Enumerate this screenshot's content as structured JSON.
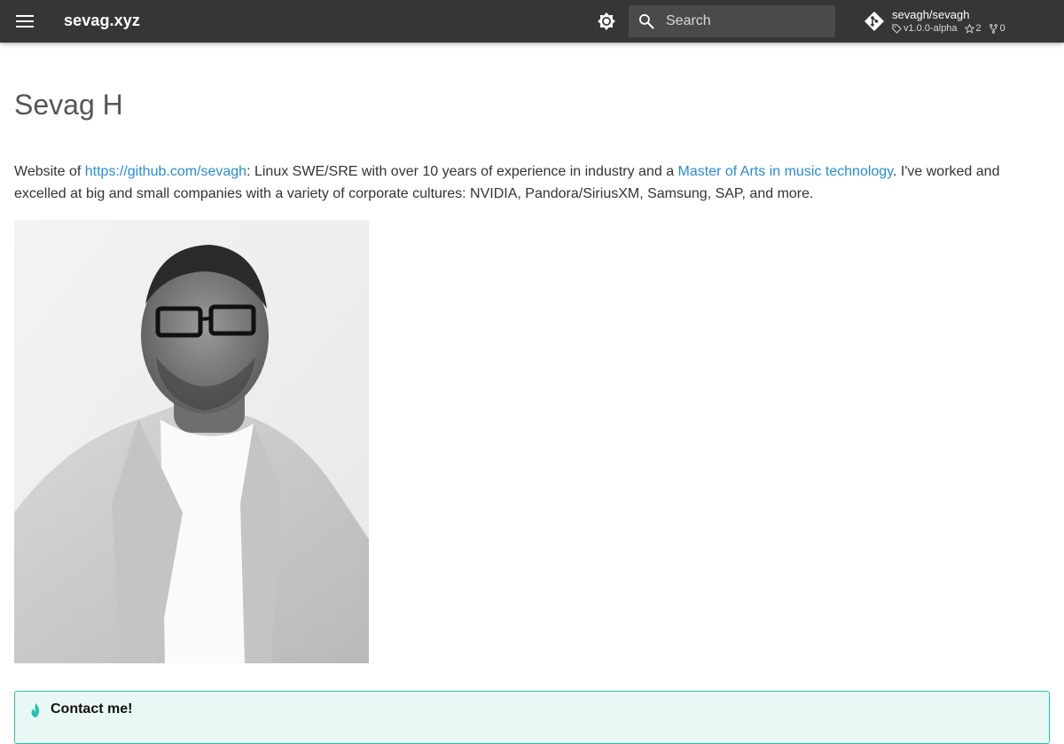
{
  "header": {
    "site_title": "sevag.xyz",
    "menu_icon": "menu-icon",
    "theme_icon": "brightness-icon",
    "search": {
      "placeholder": "Search",
      "value": ""
    },
    "repo": {
      "name": "sevagh/sevagh",
      "version": "v1.0.0-alpha",
      "stars": "2",
      "forks": "0"
    }
  },
  "main": {
    "title": "Sevag H",
    "intro": {
      "prefix": "Website of ",
      "github_link": "https://github.com/sevagh",
      "middle": ": Linux SWE/SRE with over 10 years of experience in industry and a ",
      "degree_link": "Master of Arts in music technology",
      "suffix": ". I've worked and excelled at big and small companies with a variety of corporate cultures: NVIDIA, Pandora/SiriusXM, Samsung, SAP, and more."
    },
    "portrait_icon": "portrait-photo"
  },
  "admonition": {
    "title": "Contact me!",
    "icon": "fire-icon"
  },
  "colors": {
    "header_bg": "#363636",
    "link": "#2a8ccc",
    "admonition_border": "#2bbfae"
  }
}
